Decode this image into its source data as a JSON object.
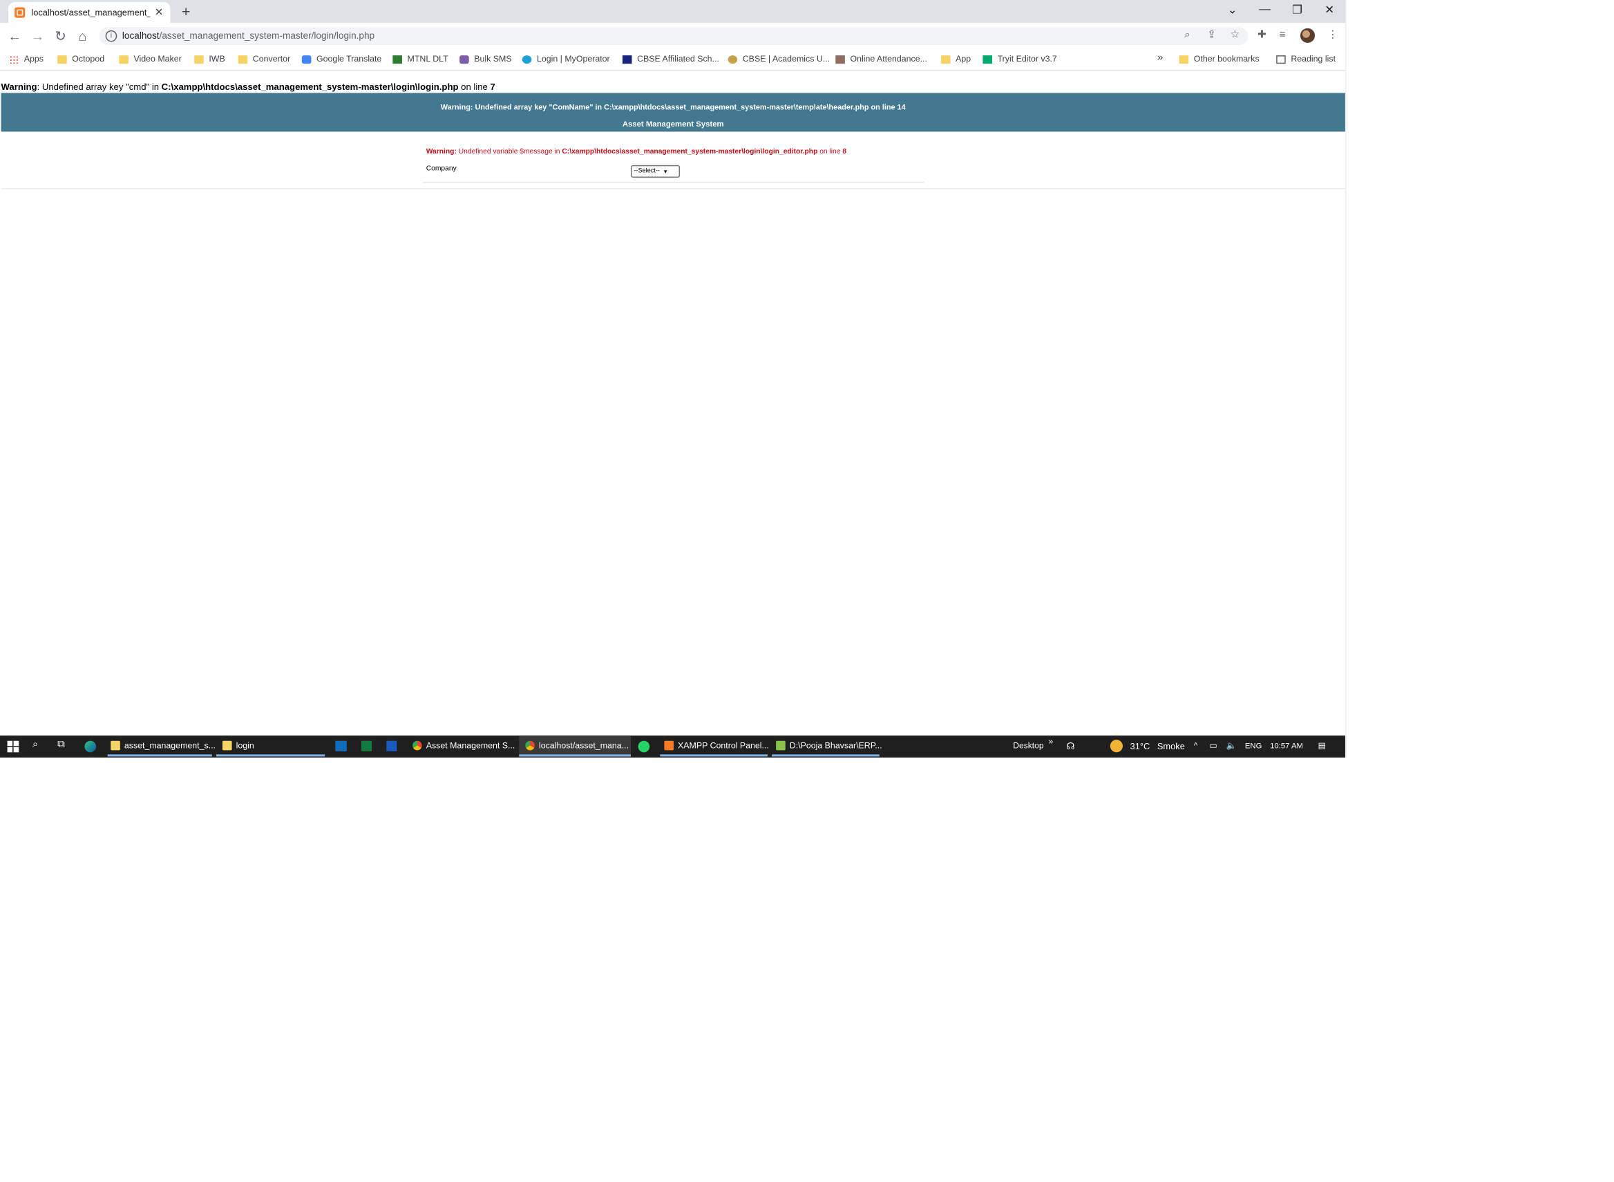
{
  "browser": {
    "tab_title": "localhost/asset_management_sy",
    "tab_close": "✕",
    "new_tab": "+",
    "url_host": "localhost",
    "url_path": "/asset_management_system-master/login/login.php",
    "window_controls": [
      "⌄",
      "—",
      "❐",
      "✕"
    ]
  },
  "bookmarks": [
    {
      "label": "Apps",
      "icon": "apps-grid-icon"
    },
    {
      "label": "Octopod",
      "icon": "folder-icon"
    },
    {
      "label": "Video Maker",
      "icon": "folder-icon"
    },
    {
      "label": "IWB",
      "icon": "folder-icon"
    },
    {
      "label": "Convertor",
      "icon": "folder-icon"
    },
    {
      "label": "Google Translate",
      "icon": "translate-icon"
    },
    {
      "label": "MTNL DLT",
      "icon": "site-icon"
    },
    {
      "label": "Bulk SMS",
      "icon": "site-icon"
    },
    {
      "label": "Login | MyOperator",
      "icon": "site-icon"
    },
    {
      "label": "CBSE Affiliated Sch...",
      "icon": "site-icon"
    },
    {
      "label": "CBSE | Academics U...",
      "icon": "site-icon"
    },
    {
      "label": "Online Attendance...",
      "icon": "site-icon"
    },
    {
      "label": "App",
      "icon": "folder-icon"
    },
    {
      "label": "Tryit Editor v3.7",
      "icon": "w3-icon"
    }
  ],
  "bookmarks_overflow": "»",
  "other_bookmarks": "Other bookmarks",
  "reading_list": "Reading list",
  "page": {
    "warning1": {
      "prefix": "Warning",
      "text": ": Undefined array key \"cmd\" in ",
      "path": "C:\\xampp\\htdocs\\asset_management_system-master\\login\\login.php",
      "on_line": " on line ",
      "line": "7"
    },
    "warning2": "Warning: Undefined array key \"ComName\" in C:\\xampp\\htdocs\\asset_management_system-master\\template\\header.php on line 14",
    "app_title": "Asset Management System",
    "warning3": {
      "prefix": "Warning:",
      "text": " Undefined variable $message in ",
      "path": "C:\\xampp\\htdocs\\asset_management_system-master\\login\\login_editor.php",
      "on_line": " on line ",
      "line": "8"
    },
    "company_label": "Company",
    "company_select_value": "--Select--"
  },
  "taskbar": {
    "items": [
      {
        "label": "asset_management_s...",
        "icon": "folder-icon"
      },
      {
        "label": "login",
        "icon": "folder-icon"
      },
      {
        "label": "Asset Management S...",
        "icon": "chrome-icon"
      },
      {
        "label": "localhost/asset_mana...",
        "icon": "chrome-icon"
      },
      {
        "label": "XAMPP Control Panel...",
        "icon": "xampp-icon"
      },
      {
        "label": "D:\\Pooja Bhavsar\\ERP...",
        "icon": "notepad-icon"
      }
    ],
    "desktop": "Desktop",
    "desktop_chevron": "»",
    "temperature": "31°C",
    "weather": "Smoke",
    "language": "ENG",
    "time": "10:57 AM"
  },
  "colors": {
    "header_band": "#437891",
    "warning_red": "#c0101a",
    "taskbar": "#1f1f1f"
  }
}
